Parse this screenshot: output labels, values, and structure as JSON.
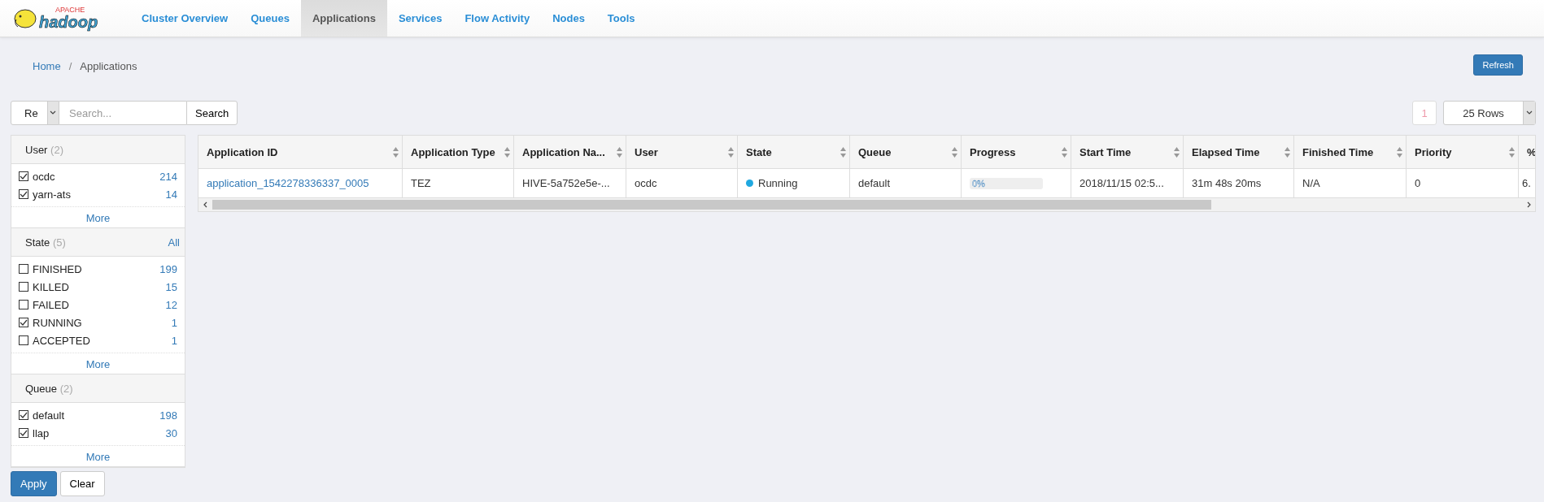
{
  "logo": {
    "top": "APACHE",
    "word": "hadoop"
  },
  "nav": [
    {
      "label": "Cluster Overview",
      "selected": false
    },
    {
      "label": "Queues",
      "selected": false
    },
    {
      "label": "Applications",
      "selected": true
    },
    {
      "label": "Services",
      "selected": false
    },
    {
      "label": "Flow Activity",
      "selected": false
    },
    {
      "label": "Nodes",
      "selected": false
    },
    {
      "label": "Tools",
      "selected": false
    }
  ],
  "breadcrumb_separator": "/",
  "breadcrumb": [
    {
      "label": "Home",
      "kind": "link"
    },
    {
      "label": "Applications",
      "kind": "current"
    }
  ],
  "refresh_button": "Refresh",
  "search": {
    "mode": "Re",
    "placeholder": "Search...",
    "button": "Search"
  },
  "pagination": {
    "page": "1",
    "rows": "25 Rows"
  },
  "facets": [
    {
      "title": "User",
      "count": "(2)",
      "items": [
        {
          "label": "ocdc",
          "count": "214",
          "checked": true
        },
        {
          "label": "yarn-ats",
          "count": "14",
          "checked": true
        }
      ],
      "more": "More"
    },
    {
      "title": "State",
      "count": "(5)",
      "all": "All",
      "items": [
        {
          "label": "FINISHED",
          "count": "199",
          "checked": false
        },
        {
          "label": "KILLED",
          "count": "15",
          "checked": false
        },
        {
          "label": "FAILED",
          "count": "12",
          "checked": false
        },
        {
          "label": "RUNNING",
          "count": "1",
          "checked": true
        },
        {
          "label": "ACCEPTED",
          "count": "1",
          "checked": false
        }
      ],
      "more": "More"
    },
    {
      "title": "Queue",
      "count": "(2)",
      "items": [
        {
          "label": "default",
          "count": "198",
          "checked": true
        },
        {
          "label": "llap",
          "count": "30",
          "checked": true
        }
      ],
      "more": "More"
    }
  ],
  "filter_buttons": {
    "apply": "Apply",
    "clear": "Clear"
  },
  "table": {
    "columns": [
      "Application ID",
      "Application Type",
      "Application Na...",
      "User",
      "State",
      "Queue",
      "Progress",
      "Start Time",
      "Elapsed Time",
      "Finished Time",
      "Priority",
      "%"
    ],
    "rows": [
      {
        "id": "application_1542278336337_0005",
        "type": "TEZ",
        "name": "HIVE-5a752e5e-...",
        "user": "ocdc",
        "state": "Running",
        "color": "#1fa8e0",
        "queue": "default",
        "progress": {
          "level": 0,
          "label": "0%"
        },
        "start": "2018/11/15 02:5...",
        "elapsed": "31m 48s 20ms",
        "finished": "N/A",
        "priority": "0",
        "percent": "6."
      }
    ]
  }
}
